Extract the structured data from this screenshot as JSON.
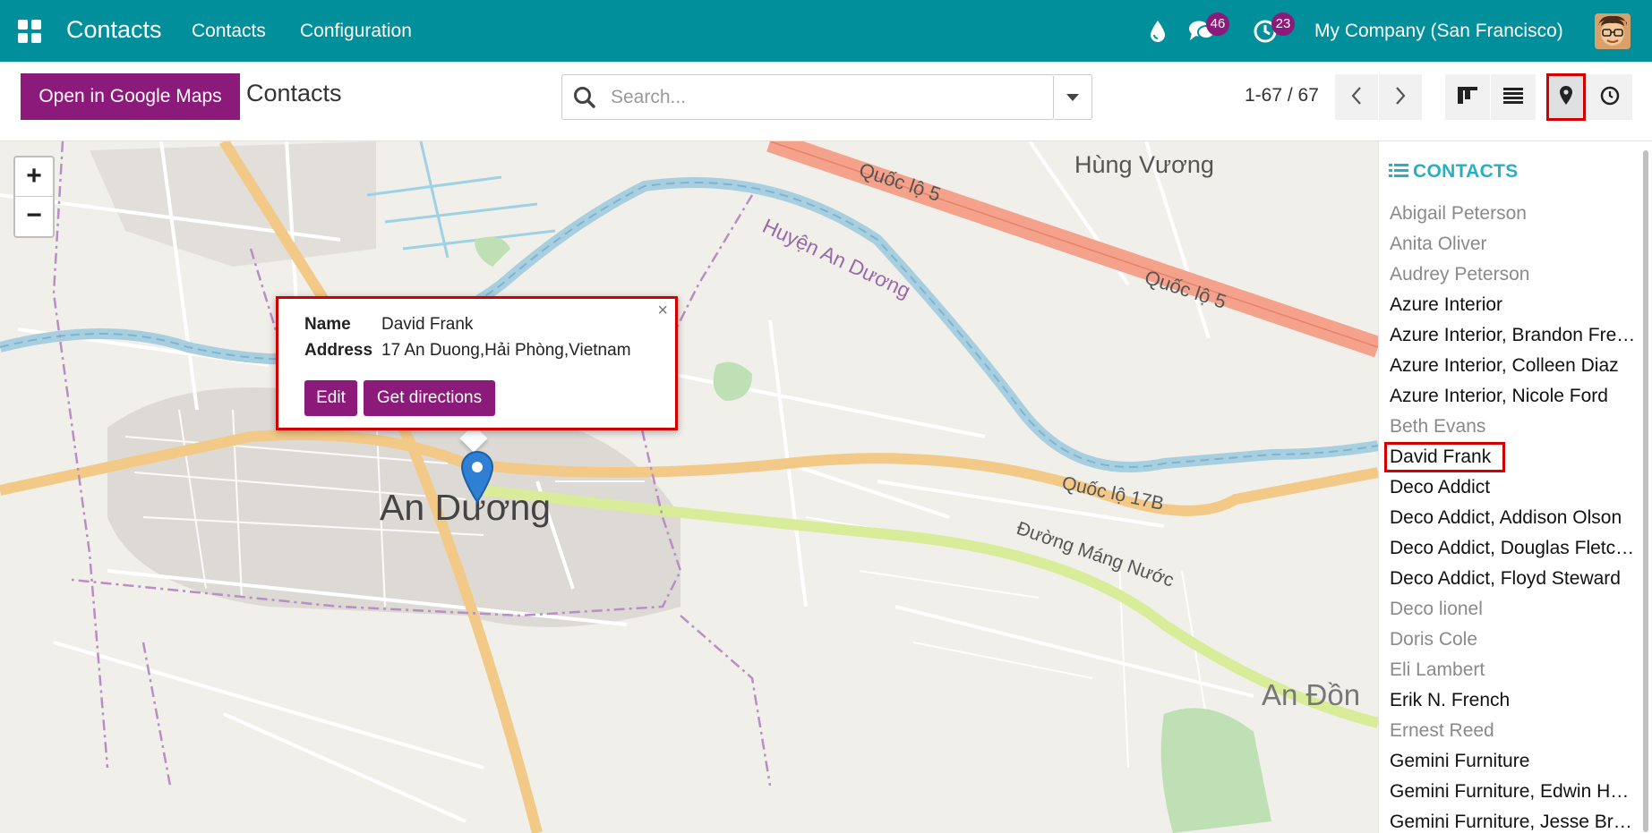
{
  "navbar": {
    "app_title": "Contacts",
    "menu": [
      "Contacts",
      "Configuration"
    ],
    "messages_count": "46",
    "activities_count": "23",
    "company": "My Company (San Francisco)",
    "bg_color": "#008f9b",
    "badge_color": "#8b1a7a"
  },
  "control": {
    "google_maps_label": "Open in Google Maps",
    "title": "Contacts",
    "search_placeholder": "Search...",
    "pager": "1-67 / 67",
    "views": [
      "kanban-icon",
      "list-icon",
      "map-marker-icon",
      "clock-icon"
    ],
    "active_view": "map"
  },
  "map": {
    "zoom_in": "+",
    "zoom_out": "−",
    "labels": [
      "Hùng Vương",
      "Quốc lộ 5",
      "Huyện An Dương",
      "Quốc lộ 17B",
      "An Dương",
      "Đường Máng Nước",
      "An Đồn"
    ],
    "popup": {
      "name_label": "Name",
      "name_value": "David Frank",
      "address_label": "Address",
      "address_value": "17 An Duong,Hải Phòng,Vietnam",
      "close": "×",
      "edit_label": "Edit",
      "directions_label": "Get directions"
    }
  },
  "sidebar": {
    "header": "CONTACTS",
    "items": [
      {
        "label": "Abigail Peterson",
        "located": false
      },
      {
        "label": "Anita Oliver",
        "located": false
      },
      {
        "label": "Audrey Peterson",
        "located": false
      },
      {
        "label": "Azure Interior",
        "located": true
      },
      {
        "label": "Azure Interior, Brandon Freeman",
        "located": true
      },
      {
        "label": "Azure Interior, Colleen Diaz",
        "located": true
      },
      {
        "label": "Azure Interior, Nicole Ford",
        "located": true
      },
      {
        "label": "Beth Evans",
        "located": false
      },
      {
        "label": "David Frank",
        "located": true,
        "selected": true
      },
      {
        "label": "Deco Addict",
        "located": true
      },
      {
        "label": "Deco Addict, Addison Olson",
        "located": true
      },
      {
        "label": "Deco Addict, Douglas Fletcher",
        "located": true
      },
      {
        "label": "Deco Addict, Floyd Steward",
        "located": true
      },
      {
        "label": "Deco lionel",
        "located": false
      },
      {
        "label": "Doris Cole",
        "located": false
      },
      {
        "label": "Eli Lambert",
        "located": false
      },
      {
        "label": "Erik N. French",
        "located": true
      },
      {
        "label": "Ernest Reed",
        "located": false
      },
      {
        "label": "Gemini Furniture",
        "located": true
      },
      {
        "label": "Gemini Furniture, Edwin Hansen",
        "located": true
      },
      {
        "label": "Gemini Furniture, Jesse Brown",
        "located": true
      }
    ]
  }
}
